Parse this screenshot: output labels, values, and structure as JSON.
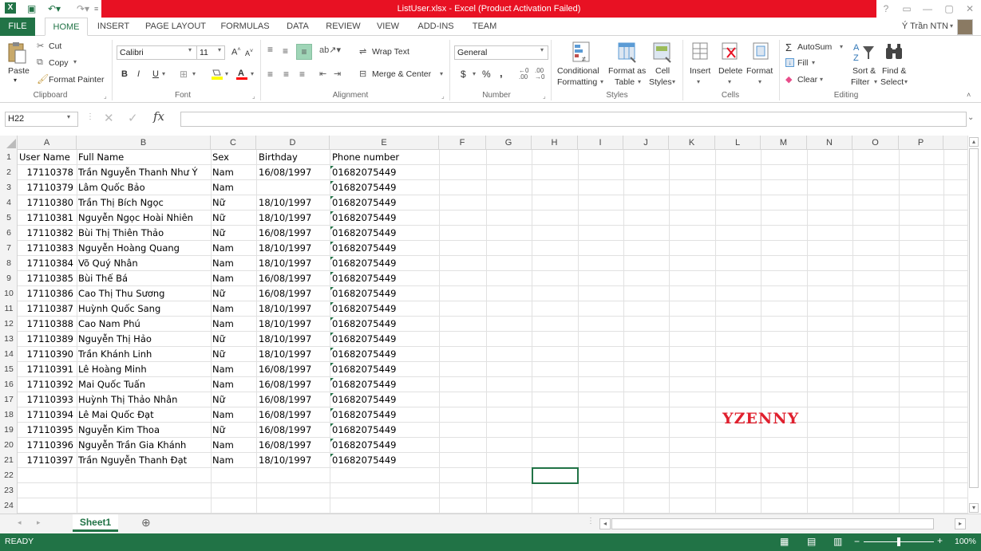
{
  "window": {
    "title": "ListUser.xlsx -  Excel (Product Activation Failed)",
    "controls": [
      "?",
      "▭",
      "—",
      "▢",
      "✕"
    ]
  },
  "tabs": {
    "file": "FILE",
    "items": [
      "HOME",
      "INSERT",
      "PAGE LAYOUT",
      "FORMULAS",
      "DATA",
      "REVIEW",
      "VIEW",
      "ADD-INS",
      "TEAM"
    ],
    "active": "HOME",
    "user": "Ý Trần NTN"
  },
  "clipboard": {
    "paste": "Paste",
    "cut": "Cut",
    "copy": "Copy",
    "format_painter": "Format Painter",
    "label": "Clipboard"
  },
  "font": {
    "name": "Calibri",
    "size": "11",
    "label": "Font",
    "bold": "B",
    "italic": "I",
    "underline": "U"
  },
  "alignment": {
    "wrap": "Wrap Text",
    "merge": "Merge & Center",
    "label": "Alignment"
  },
  "number": {
    "format": "General",
    "currency": "$",
    "percent": "%",
    "comma": ",",
    "label": "Number"
  },
  "styles": {
    "conditional": [
      "Conditional",
      "Formatting"
    ],
    "format_table": [
      "Format as",
      "Table"
    ],
    "cell_styles": [
      "Cell",
      "Styles"
    ],
    "label": "Styles"
  },
  "cells": {
    "insert": "Insert",
    "delete": "Delete",
    "format": "Format",
    "label": "Cells"
  },
  "editing": {
    "autosum": "AutoSum",
    "fill": "Fill",
    "clear": "Clear",
    "sort": [
      "Sort &",
      "Filter"
    ],
    "find": [
      "Find &",
      "Select"
    ],
    "label": "Editing"
  },
  "formula_bar": {
    "name_box": "H22",
    "cancel": "✕",
    "enter": "✓",
    "fx": "fx",
    "content": ""
  },
  "columns": [
    "A",
    "B",
    "C",
    "D",
    "E",
    "F",
    "G",
    "H",
    "I",
    "J",
    "K",
    "L",
    "M",
    "N",
    "O",
    "P"
  ],
  "rows": [
    "1",
    "2",
    "3",
    "4",
    "5",
    "6",
    "7",
    "8",
    "9",
    "10",
    "11",
    "12",
    "13",
    "14",
    "15",
    "16",
    "17",
    "18",
    "19",
    "20",
    "21",
    "22",
    "23",
    "24"
  ],
  "sheet": {
    "headers": [
      "User Name",
      "Full Name",
      "Sex",
      "Birthday",
      "Phone number"
    ],
    "data": [
      [
        "17110378",
        "Trần Nguyễn Thanh Như Ý",
        "Nam",
        "16/08/1997",
        "01682075449"
      ],
      [
        "17110379",
        "Lâm Quốc Bảo",
        "Nam",
        "",
        "01682075449"
      ],
      [
        "17110380",
        "Trần Thị Bích Ngọc",
        "Nữ",
        "18/10/1997",
        "01682075449"
      ],
      [
        "17110381",
        "Nguyễn Ngọc Hoài Nhiên",
        "Nữ",
        "18/10/1997",
        "01682075449"
      ],
      [
        "17110382",
        "Bùi Thị Thiên Thảo",
        "Nữ",
        "16/08/1997",
        "01682075449"
      ],
      [
        "17110383",
        "Nguyễn Hoàng Quang",
        "Nam",
        "18/10/1997",
        "01682075449"
      ],
      [
        "17110384",
        "Võ Quý Nhân",
        "Nam",
        "18/10/1997",
        "01682075449"
      ],
      [
        "17110385",
        "Bùi Thế Bá",
        "Nam",
        "16/08/1997",
        "01682075449"
      ],
      [
        "17110386",
        "Cao Thị Thu Sương",
        "Nữ",
        "16/08/1997",
        "01682075449"
      ],
      [
        "17110387",
        "Huỳnh Quốc Sang",
        "Nam",
        "18/10/1997",
        "01682075449"
      ],
      [
        "17110388",
        "Cao Nam Phú",
        "Nam",
        "18/10/1997",
        "01682075449"
      ],
      [
        "17110389",
        "Nguyễn Thị Hảo",
        "Nữ",
        "18/10/1997",
        "01682075449"
      ],
      [
        "17110390",
        "Trần Khánh Linh",
        "Nữ",
        "18/10/1997",
        "01682075449"
      ],
      [
        "17110391",
        "Lê Hoàng Minh",
        "Nam",
        "16/08/1997",
        "01682075449"
      ],
      [
        "17110392",
        "Mai Quốc Tuấn",
        "Nam",
        "16/08/1997",
        "01682075449"
      ],
      [
        "17110393",
        "Huỳnh Thị Thảo Nhân",
        "Nữ",
        "16/08/1997",
        "01682075449"
      ],
      [
        "17110394",
        "Lê Mai Quốc Đạt",
        "Nam",
        "16/08/1997",
        "01682075449"
      ],
      [
        "17110395",
        "Nguyễn Kim Thoa",
        "Nữ",
        "16/08/1997",
        "01682075449"
      ],
      [
        "17110396",
        "Nguyễn Trần Gia Khánh",
        "Nam",
        "16/08/1997",
        "01682075449"
      ],
      [
        "17110397",
        "Trần Nguyễn Thanh Đạt",
        "Nam",
        "18/10/1997",
        "01682075449"
      ]
    ]
  },
  "watermark": "YZENNY",
  "sheet_tabs": {
    "active": "Sheet1",
    "add": "⊕"
  },
  "status": {
    "text": "READY",
    "zoom": "100%"
  },
  "colors": {
    "accent": "#217346",
    "title_red": "#e81123",
    "watermark": "#e0202e"
  }
}
